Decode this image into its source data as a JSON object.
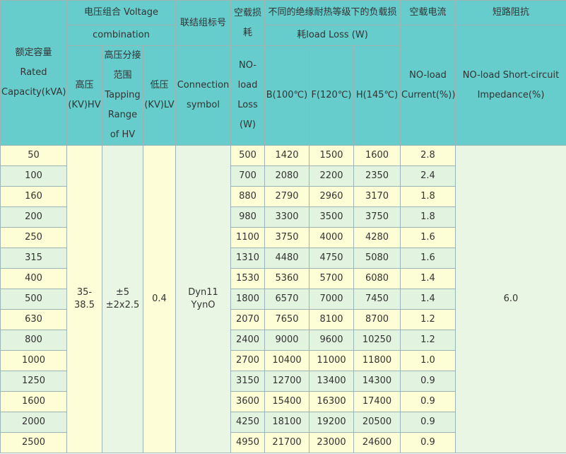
{
  "header": {
    "rated_capacity": "额定容量 Rated Capacity(kVA)",
    "voltage_combination_cn": "电压组合 Voltage",
    "voltage_combination_en": "combination",
    "hv": "高压 (KV)HV",
    "tapping_range": "高压分接范围 Tapping Range of HV",
    "lv": "低压 (KV)LV",
    "connection_cn": "联结组标号",
    "connection_en": "Connection symbol",
    "no_load_loss_cn": "空载损耗",
    "no_load_loss_en": "NO-load Loss (W)",
    "load_loss_cn": "不同的绝缘耐热等级下的负载损",
    "load_loss_en": "耗load Loss (W)",
    "b_class": "B(100℃)",
    "f_class": "F(120℃)",
    "h_class": "H(145℃)",
    "no_load_current_cn": "空载电流",
    "no_load_current_en": "NO-load Current(%))",
    "impedance_cn": "短路阻抗",
    "impedance_en": "NO-load Short-circuit Impedance(%)"
  },
  "merged": {
    "hv": "35-38.5",
    "tapping_line1": "±5",
    "tapping_line2": "±2x2.5",
    "lv": "0.4",
    "connection_line1": "Dyn11",
    "connection_line2": "YynO",
    "impedance": "6.0"
  },
  "rows": [
    {
      "capacity": "50",
      "no_load_loss": "500",
      "b": "1420",
      "f": "1500",
      "h": "1600",
      "current": "2.8"
    },
    {
      "capacity": "100",
      "no_load_loss": "700",
      "b": "2080",
      "f": "2200",
      "h": "2350",
      "current": "2.4"
    },
    {
      "capacity": "160",
      "no_load_loss": "880",
      "b": "2790",
      "f": "2960",
      "h": "3170",
      "current": "1.8"
    },
    {
      "capacity": "200",
      "no_load_loss": "980",
      "b": "3300",
      "f": "3500",
      "h": "3750",
      "current": "1.8"
    },
    {
      "capacity": "250",
      "no_load_loss": "1100",
      "b": "3750",
      "f": "4000",
      "h": "4280",
      "current": "1.6"
    },
    {
      "capacity": "315",
      "no_load_loss": "1310",
      "b": "4480",
      "f": "4750",
      "h": "5080",
      "current": "1.6"
    },
    {
      "capacity": "400",
      "no_load_loss": "1530",
      "b": "5360",
      "f": "5700",
      "h": "6080",
      "current": "1.4"
    },
    {
      "capacity": "500",
      "no_load_loss": "1800",
      "b": "6570",
      "f": "7000",
      "h": "7450",
      "current": "1.4"
    },
    {
      "capacity": "630",
      "no_load_loss": "2070",
      "b": "7650",
      "f": "8100",
      "h": "8700",
      "current": "1.2"
    },
    {
      "capacity": "800",
      "no_load_loss": "2400",
      "b": "9000",
      "f": "9600",
      "h": "10250",
      "current": "1.2"
    },
    {
      "capacity": "1000",
      "no_load_loss": "2700",
      "b": "10400",
      "f": "11000",
      "h": "11800",
      "current": "1.0"
    },
    {
      "capacity": "1250",
      "no_load_loss": "3150",
      "b": "12700",
      "f": "13400",
      "h": "14300",
      "current": "0.9"
    },
    {
      "capacity": "1600",
      "no_load_loss": "3600",
      "b": "15400",
      "f": "16300",
      "h": "17400",
      "current": "0.9"
    },
    {
      "capacity": "2000",
      "no_load_loss": "4250",
      "b": "18100",
      "f": "19200",
      "h": "20500",
      "current": "0.9"
    },
    {
      "capacity": "2500",
      "no_load_loss": "4950",
      "b": "21700",
      "f": "23000",
      "h": "24600",
      "current": "0.9"
    }
  ]
}
